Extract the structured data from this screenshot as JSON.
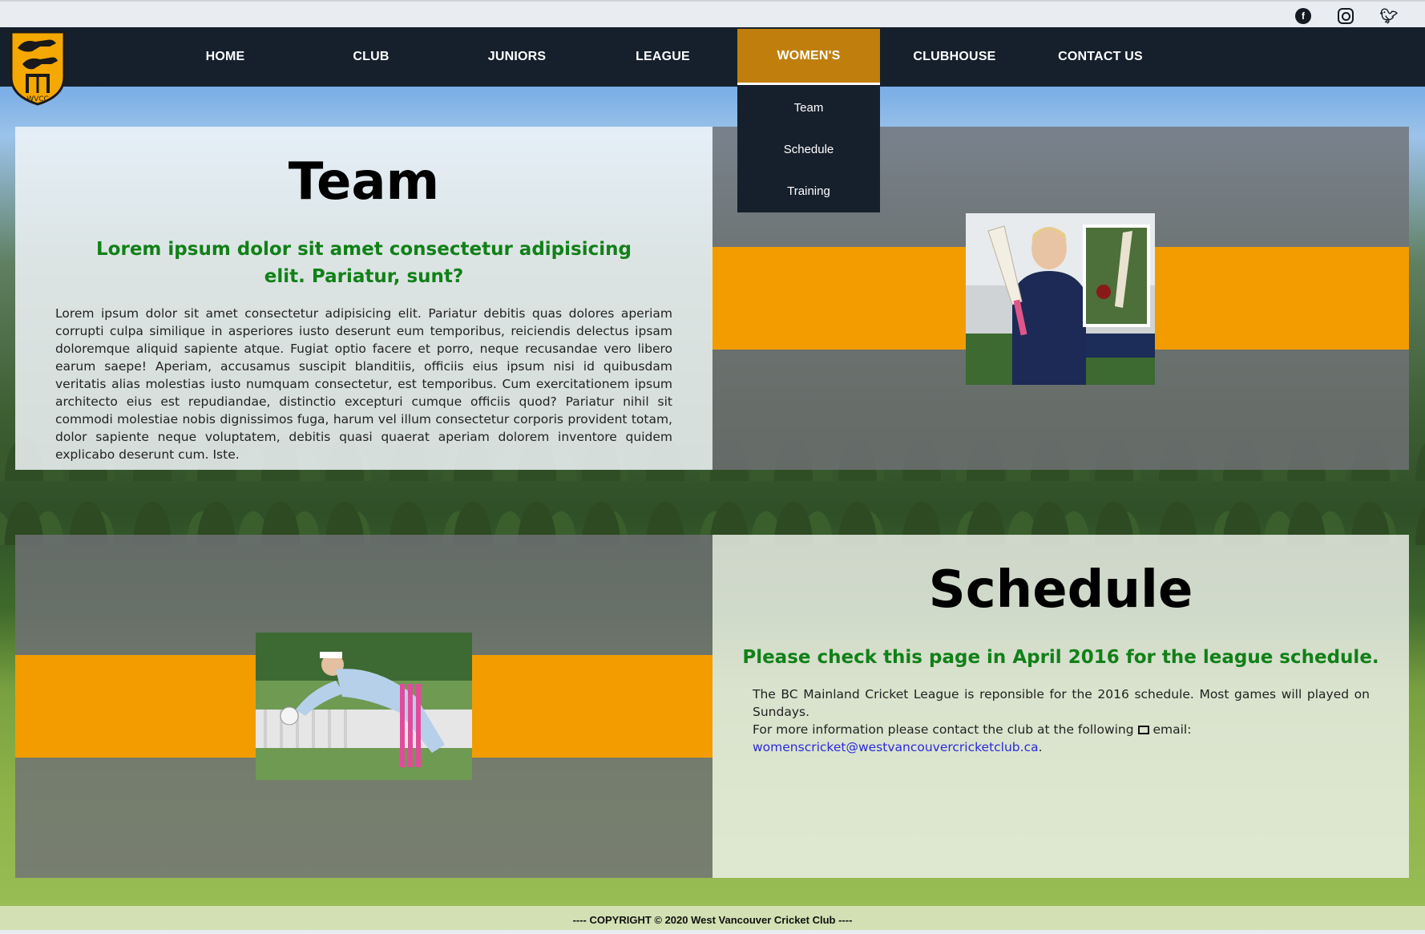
{
  "social": {
    "facebook_icon": "facebook-icon",
    "instagram_icon": "instagram-icon",
    "twitter_icon": "twitter-icon"
  },
  "logo": {
    "text": "WVCC"
  },
  "nav": {
    "items": [
      {
        "label": "HOME"
      },
      {
        "label": "CLUB"
      },
      {
        "label": "JUNIORS"
      },
      {
        "label": "LEAGUE"
      },
      {
        "label": "WOMEN'S"
      },
      {
        "label": "CLUBHOUSE"
      },
      {
        "label": "CONTACT US"
      }
    ],
    "active_index": 4
  },
  "dropdown": {
    "items": [
      {
        "label": "Team"
      },
      {
        "label": "Schedule"
      },
      {
        "label": "Training"
      }
    ]
  },
  "team": {
    "title": "Team",
    "subtitle": "Lorem ipsum dolor sit amet consectetur adipisicing elit. Pariatur, sunt?",
    "body": "Lorem ipsum dolor sit amet consectetur adipisicing elit. Pariatur debitis quas dolores aperiam corrupti culpa similique in asperiores iusto deserunt eum temporibus, reiciendis delectus ipsam doloremque aliquid sapiente atque. Fugiat optio facere et porro, neque recusandae vero libero earum saepe! Aperiam, accusamus suscipit blanditiis, officiis eius ipsum nisi id quibusdam veritatis alias molestias iusto numquam consectetur, est temporibus. Cum exercitationem ipsum architecto eius est repudiandae, distinctio excepturi cumque officiis quod? Pariatur nihil sit commodi molestiae nobis dignissimos fuga, harum vel illum consectetur corporis provident totam, dolor sapiente neque voluptatem, debitis quasi quaerat aperiam dolorem inventore quidem explicabo deserunt cum. Iste."
  },
  "schedule": {
    "title": "Schedule",
    "subtitle": "Please check this page in April 2016 for the league schedule.",
    "line1": "The BC Mainland Cricket League is reponsible for the 2016 schedule. Most games will played on Sundays.",
    "line2_prefix": "For more information please contact the club at the following",
    "line2_suffix": "email:",
    "email": "womenscricket@westvancouvercricketclub.ca",
    "email_end": "."
  },
  "footer": {
    "copyright": "---- COPYRIGHT © 2020 West Vancouver Cricket Club ----"
  },
  "colors": {
    "nav_bg": "#16202c",
    "nav_active": "#c07f0d",
    "stripe_orange": "#f39c00",
    "subtitle_green": "#118018",
    "link_blue": "#2a2ad8"
  }
}
